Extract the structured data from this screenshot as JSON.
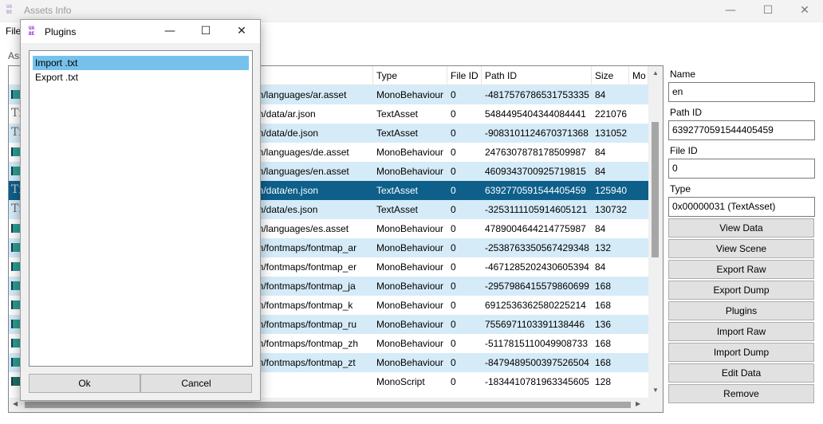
{
  "window": {
    "title": "Assets Info",
    "app_icon_text": "UABE",
    "controls": {
      "minimize": "—",
      "maximize": "☐",
      "close": "✕"
    }
  },
  "menu": {
    "file": "File"
  },
  "assets_label": "Ass",
  "table": {
    "columns": [
      "Type",
      "File ID",
      "Path ID",
      "Size",
      "Mo"
    ],
    "rows": [
      {
        "icon": "monobehaviour-icon",
        "name": "tion/languages/ar.asset",
        "type": "MonoBehaviour",
        "file_id": "0",
        "path_id": "-4817576786531753335",
        "size": "84"
      },
      {
        "icon": "textasset-icon",
        "name": "tion/data/ar.json",
        "type": "TextAsset",
        "file_id": "0",
        "path_id": "5484495404344084441",
        "size": "221076"
      },
      {
        "icon": "textasset-icon",
        "name": "tion/data/de.json",
        "type": "TextAsset",
        "file_id": "0",
        "path_id": "-9083101124670371368",
        "size": "131052"
      },
      {
        "icon": "monobehaviour-icon",
        "name": "tion/languages/de.asset",
        "type": "MonoBehaviour",
        "file_id": "0",
        "path_id": "2476307878178509987",
        "size": "84"
      },
      {
        "icon": "monobehaviour-icon",
        "name": "tion/languages/en.asset",
        "type": "MonoBehaviour",
        "file_id": "0",
        "path_id": "4609343700925719815",
        "size": "84"
      },
      {
        "icon": "textasset-icon",
        "name": "tion/data/en.json",
        "type": "TextAsset",
        "file_id": "0",
        "path_id": "6392770591544405459",
        "size": "125940"
      },
      {
        "icon": "textasset-icon",
        "name": "tion/data/es.json",
        "type": "TextAsset",
        "file_id": "0",
        "path_id": "-3253111105914605121",
        "size": "130732"
      },
      {
        "icon": "monobehaviour-icon",
        "name": "tion/languages/es.asset",
        "type": "MonoBehaviour",
        "file_id": "0",
        "path_id": "4789004644214775987",
        "size": "84"
      },
      {
        "icon": "monobehaviour-icon",
        "name": "tion/fontmaps/fontmap_ar",
        "type": "MonoBehaviour",
        "file_id": "0",
        "path_id": "-2538763350567429348",
        "size": "132"
      },
      {
        "icon": "monobehaviour-icon",
        "name": "tion/fontmaps/fontmap_er",
        "type": "MonoBehaviour",
        "file_id": "0",
        "path_id": "-4671285202430605394",
        "size": "84"
      },
      {
        "icon": "monobehaviour-icon",
        "name": "tion/fontmaps/fontmap_ja",
        "type": "MonoBehaviour",
        "file_id": "0",
        "path_id": "-2957986415579860699",
        "size": "168"
      },
      {
        "icon": "monobehaviour-icon",
        "name": "tion/fontmaps/fontmap_k",
        "type": "MonoBehaviour",
        "file_id": "0",
        "path_id": "6912536362580225214",
        "size": "168"
      },
      {
        "icon": "monobehaviour-icon",
        "name": "tion/fontmaps/fontmap_ru",
        "type": "MonoBehaviour",
        "file_id": "0",
        "path_id": "7556971103391138446",
        "size": "136"
      },
      {
        "icon": "monobehaviour-icon",
        "name": "tion/fontmaps/fontmap_zh",
        "type": "MonoBehaviour",
        "file_id": "0",
        "path_id": "-5117815110049908733",
        "size": "168"
      },
      {
        "icon": "monobehaviour-icon",
        "name": "tion/fontmaps/fontmap_zt",
        "type": "MonoBehaviour",
        "file_id": "0",
        "path_id": "-8479489500397526504",
        "size": "168"
      },
      {
        "icon": "monoscript-icon",
        "name": "",
        "type": "MonoScript",
        "file_id": "0",
        "path_id": "-1834410781963345605",
        "size": "128"
      }
    ],
    "selected_row_index": 5
  },
  "details": {
    "name_label": "Name",
    "name_value": "en",
    "path_id_label": "Path ID",
    "path_id_value": "6392770591544405459",
    "file_id_label": "File ID",
    "file_id_value": "0",
    "type_label": "Type",
    "type_value": "0x00000031 (TextAsset)"
  },
  "actions": [
    "View Data",
    "View Scene",
    "Export Raw",
    "Export Dump",
    "Plugins",
    "Import Raw",
    "Import Dump",
    "Edit Data",
    "Remove"
  ],
  "dialog": {
    "title": "Plugins",
    "icon_text": "UABE",
    "controls": {
      "minimize": "—",
      "maximize": "☐",
      "close": "✕"
    },
    "items": [
      "Import .txt",
      "Export .txt"
    ],
    "selected_index": 0,
    "ok_label": "Ok",
    "cancel_label": "Cancel"
  },
  "colors": {
    "row_alt": "#d5ebf8",
    "row_selected": "#0e5f8a",
    "dialog_item_selected": "#76c1ec"
  }
}
